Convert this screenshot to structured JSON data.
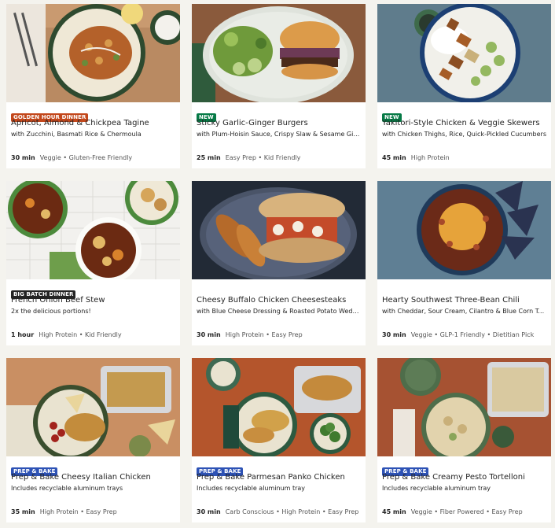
{
  "cards": [
    {
      "tag": "GOLDEN HOUR DINNER",
      "tag_color": "#c3471b",
      "title": "Apricot, Almond & Chickpea Tagine",
      "subtitle": "with Zucchini, Basmati Rice & Chermoula",
      "time": "30 min",
      "tags": "Veggie • Gluten-Free Friendly"
    },
    {
      "tag": "NEW",
      "tag_color": "#067a46",
      "title": "Sticky Garlic-Ginger Burgers",
      "subtitle": "with Plum-Hoisin Sauce, Crispy Slaw & Sesame Ginger Mayo",
      "time": "25 min",
      "tags": "Easy Prep • Kid Friendly"
    },
    {
      "tag": "NEW",
      "tag_color": "#067a46",
      "title": "Yakitori-Style Chicken & Veggie Skewers",
      "subtitle": "with Chicken Thighs, Rice, Quick-Pickled Cucumbers",
      "time": "45 min",
      "tags": "High Protein"
    },
    {
      "tag": "BIG BATCH DINNER",
      "tag_color": "#242424",
      "title": "French Onion Beef Stew",
      "subtitle": "2x the delicious portions!",
      "time": "1 hour",
      "tags": "High Protein • Kid Friendly"
    },
    {
      "tag": "",
      "tag_color": "",
      "title": "Cheesy Buffalo Chicken Cheesesteaks",
      "subtitle": "with Blue Cheese Dressing & Roasted Potato Wedges",
      "time": "30 min",
      "tags": "High Protein • Easy Prep"
    },
    {
      "tag": "",
      "tag_color": "",
      "title": "Hearty Southwest Three-Bean Chili",
      "subtitle": "with Cheddar, Sour Cream, Cilantro & Blue Corn Tortilla Chips",
      "time": "30 min",
      "tags": "Veggie • GLP-1 Friendly • Dietitian Pick"
    },
    {
      "tag": "PREP & BAKE",
      "tag_color": "#2d52b5",
      "title": "Prep & Bake Cheesy Italian Chicken",
      "subtitle": "Includes recyclable aluminum trays",
      "time": "35 min",
      "tags": "High Protein • Easy Prep"
    },
    {
      "tag": "PREP & BAKE",
      "tag_color": "#2d52b5",
      "title": "Prep & Bake Parmesan Panko Chicken",
      "subtitle": "Includes recyclable aluminum tray",
      "time": "30 min",
      "tags": "Carb Conscious • High Protein • Easy Prep"
    },
    {
      "tag": "PREP & BAKE",
      "tag_color": "#2d52b5",
      "title": "Prep & Bake Creamy Pesto Tortelloni",
      "subtitle": "Includes recyclable aluminum tray",
      "time": "45 min",
      "tags": "Veggie • Fiber Powered • Easy Prep"
    }
  ]
}
